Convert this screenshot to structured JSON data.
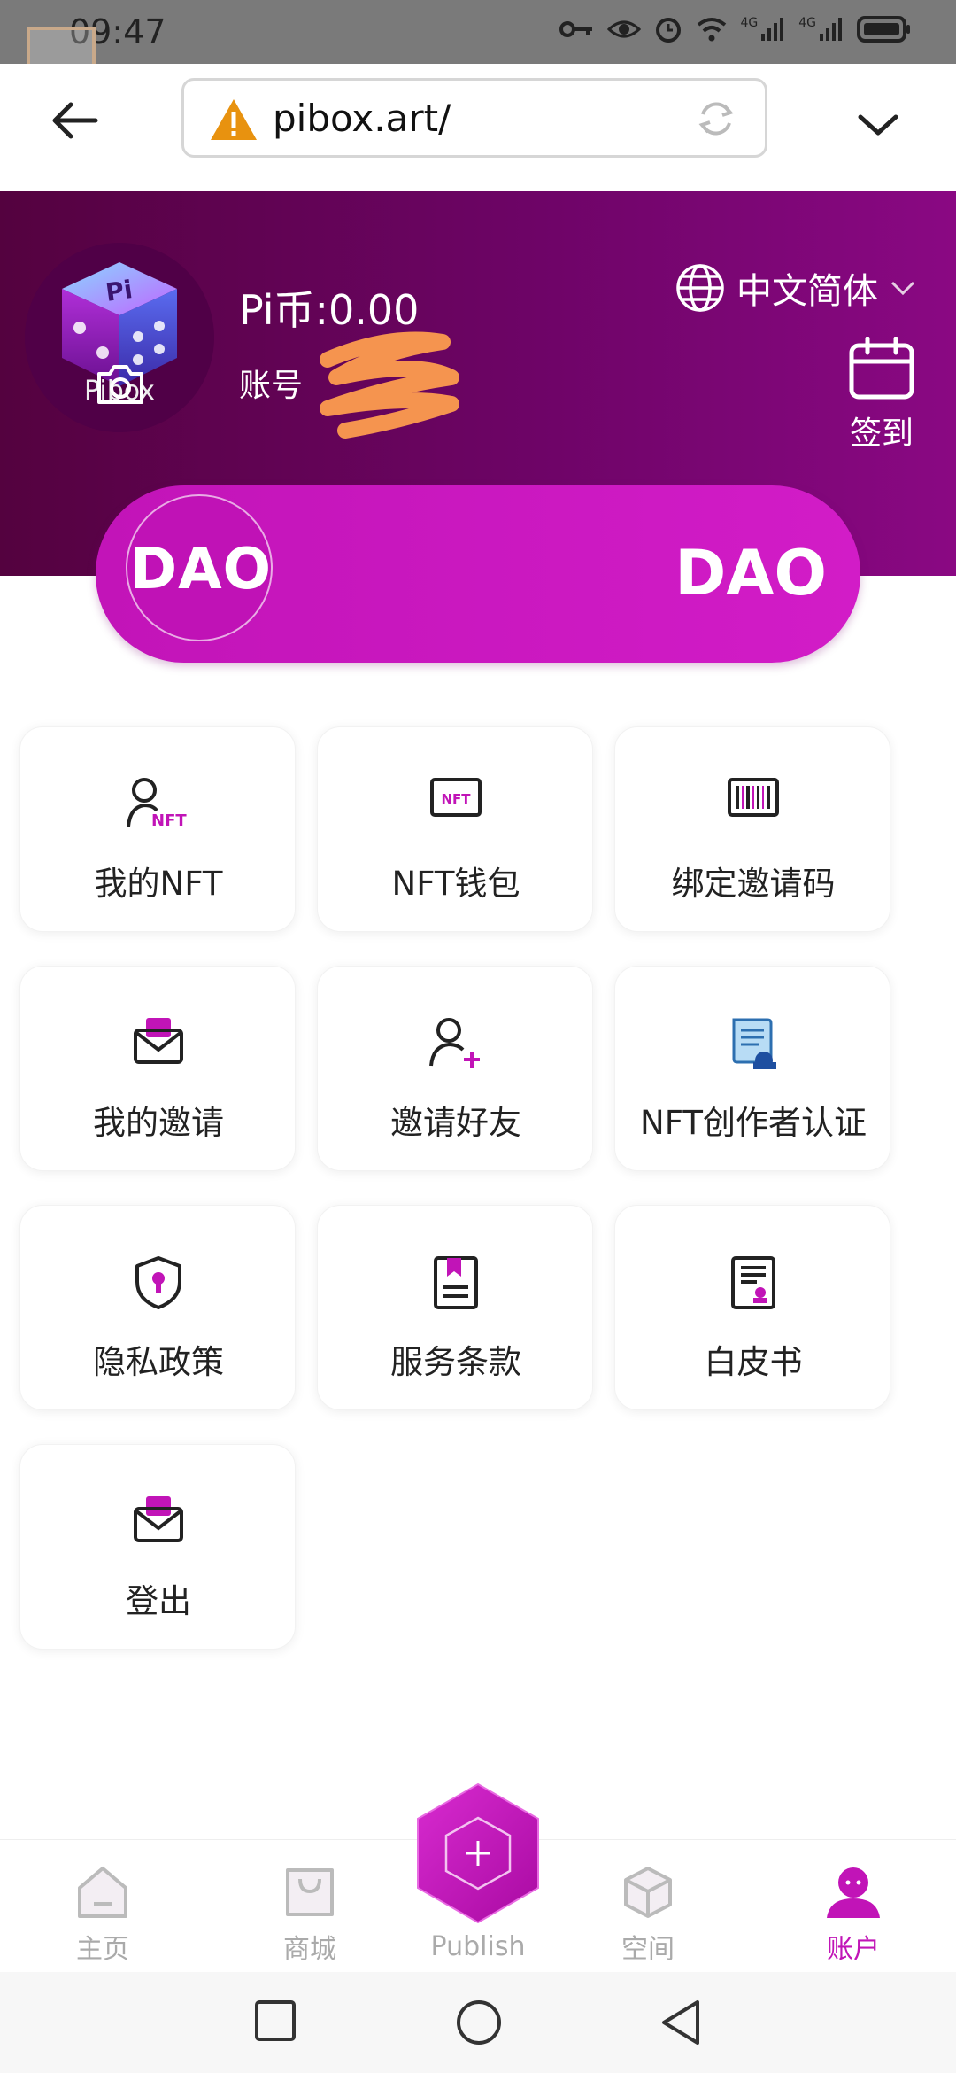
{
  "status_bar": {
    "time": "09:47",
    "network_1": "4G",
    "network_2": "4G"
  },
  "browser": {
    "url": "pibox.art/"
  },
  "profile": {
    "avatar_label": "Pibox",
    "pi_balance": "Pi币:0.00",
    "account_label": "账号",
    "language": "中文简体",
    "checkin_label": "签到"
  },
  "dao": {
    "logo_text": "DAO",
    "title": "DAO"
  },
  "menu": {
    "items": [
      {
        "label": "我的NFT",
        "icon": "user-nft-icon"
      },
      {
        "label": "NFT钱包",
        "icon": "nft-wallet-icon"
      },
      {
        "label": "绑定邀请码",
        "icon": "barcode-icon"
      },
      {
        "label": "我的邀请",
        "icon": "envelope-icon"
      },
      {
        "label": "邀请好友",
        "icon": "add-user-icon"
      },
      {
        "label": "NFT创作者认证",
        "icon": "certificate-icon"
      },
      {
        "label": "隐私政策",
        "icon": "shield-lock-icon"
      },
      {
        "label": "服务条款",
        "icon": "document-bookmark-icon"
      },
      {
        "label": "白皮书",
        "icon": "whitepaper-icon"
      },
      {
        "label": "登出",
        "icon": "envelope-icon"
      }
    ]
  },
  "bottom_nav": {
    "home": "主页",
    "mall": "商城",
    "publish": "Publish",
    "space": "空间",
    "account": "账户",
    "active_color": "#c114b7"
  },
  "colors": {
    "brand_purple": "#6d0466",
    "accent_magenta": "#c114b7"
  }
}
